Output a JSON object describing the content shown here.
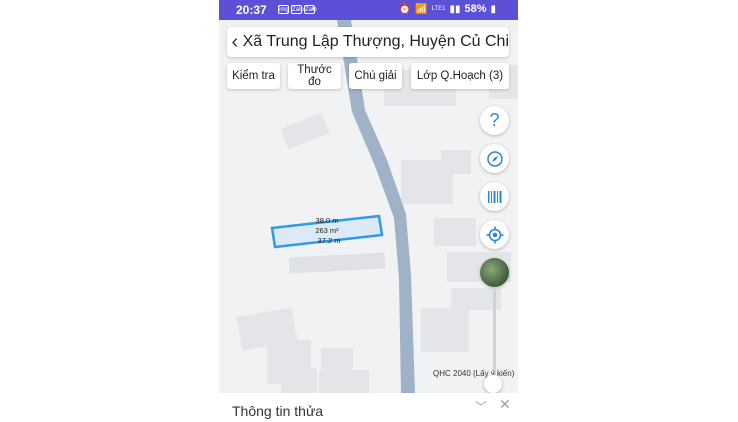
{
  "status_bar": {
    "time": "20:37",
    "notifications": [
      "img",
      "Zalo",
      "Zalo"
    ],
    "extra": "•",
    "network": "LTE1",
    "battery": "58%"
  },
  "search": {
    "title": "Xã Trung Lập Thượng, Huyện Củ Chi"
  },
  "toolbar": {
    "check_label": "Kiểm tra",
    "measure_label_line1": "Thước",
    "measure_label_line2": "đo",
    "legend_label": "Chú giải",
    "layer_label": "Lớp Q.Hoạch (3)"
  },
  "parcel": {
    "top_length": "38.0 m",
    "area": "263 m²",
    "bottom_length": "37.2 m"
  },
  "side_buttons": {
    "help_icon": "?",
    "layer_opacity_label": "QHC 2040 (Lấy ý kiến)"
  },
  "bottom_sheet": {
    "title": "Thông tin thửa"
  },
  "colors": {
    "status_bar": "#5b50d6",
    "road": "#9fb2c7",
    "parcel_border": "#2e9be6",
    "accent": "#2b86d9"
  }
}
